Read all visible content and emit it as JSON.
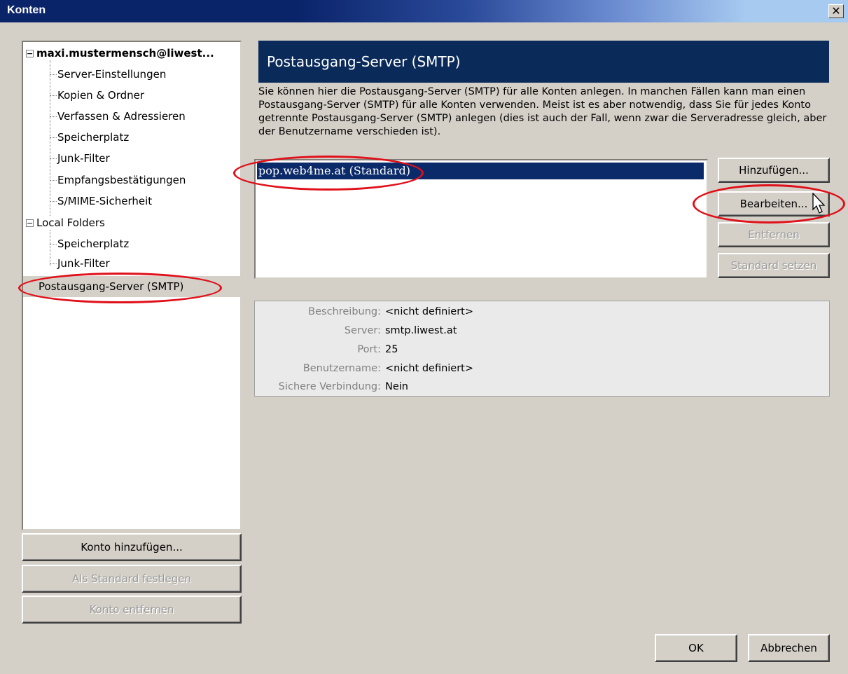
{
  "window": {
    "title": "Konten",
    "close_glyph": "✕"
  },
  "tree": {
    "account": {
      "expander": "−",
      "label": "maxi.mustermensch@liwest..."
    },
    "account_items": [
      "Server-Einstellungen",
      "Kopien & Ordner",
      "Verfassen & Adressieren",
      "Speicherplatz",
      "Junk-Filter",
      "Empfangsbestätigungen",
      "S/MIME-Sicherheit"
    ],
    "local": {
      "expander": "−",
      "label": "Local Folders"
    },
    "local_items": [
      "Speicherplatz",
      "Junk-Filter"
    ],
    "smtp": {
      "label": "Postausgang-Server (SMTP)"
    }
  },
  "left_buttons": {
    "add_account": "Konto hinzufügen...",
    "set_default": "Als Standard festlegen",
    "remove_account": "Konto entfernen"
  },
  "panel": {
    "header": "Postausgang-Server (SMTP)",
    "description": "Sie können hier die Postausgang-Server (SMTP) für alle Konten anlegen. In manchen Fällen kann man einen Postausgang-Server (SMTP) für alle Konten verwenden. Meist ist es aber notwendig, dass Sie für jedes Konto getrennte Postausgang-Server (SMTP) anlegen (dies ist auch der Fall, wenn zwar die Serveradresse gleich, aber der Benutzername verschieden ist).",
    "servers": [
      "pop.web4me.at (Standard)"
    ],
    "buttons": {
      "add": "Hinzufügen...",
      "edit": "Bearbeiten...",
      "remove": "Entfernen",
      "set_default": "Standard setzen"
    },
    "details": [
      {
        "label": "Beschreibung:",
        "value": "<nicht definiert>"
      },
      {
        "label": "Server:",
        "value": "smtp.liwest.at"
      },
      {
        "label": "Port:",
        "value": "25"
      },
      {
        "label": "Benutzername:",
        "value": "<nicht definiert>"
      },
      {
        "label": "Sichere Verbindung:",
        "value": "Nein"
      }
    ]
  },
  "dialog_buttons": {
    "ok": "OK",
    "cancel": "Abbrechen"
  },
  "colors": {
    "annotation": "#e0101a",
    "header_bg": "#0a2a5a",
    "selection": "#0a2a6a"
  }
}
